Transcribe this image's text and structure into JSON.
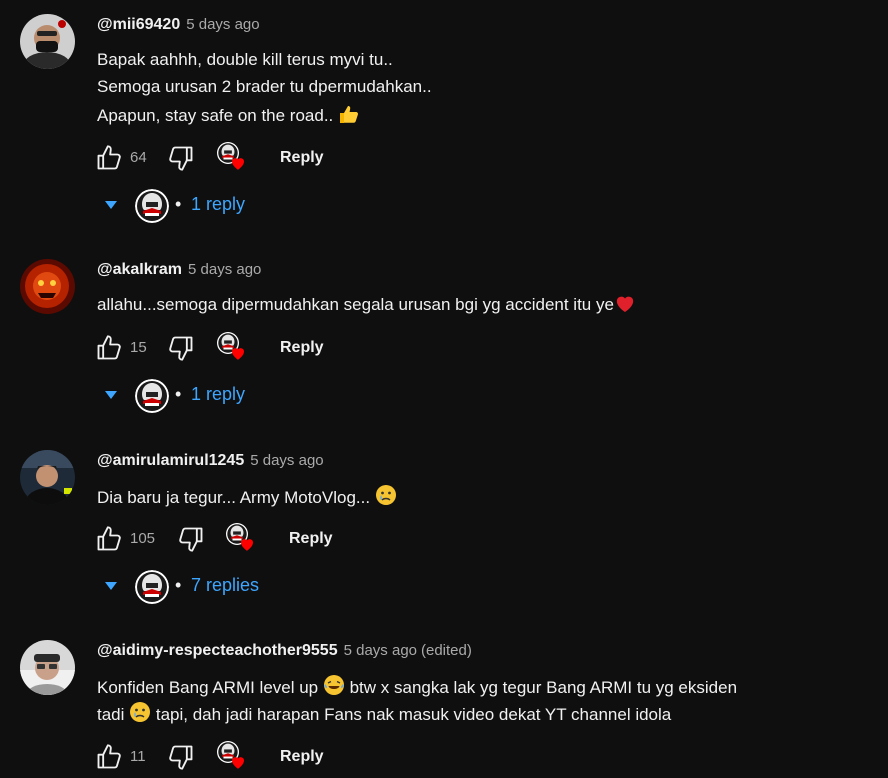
{
  "comments": [
    {
      "author": "@mii69420",
      "time": "5 days ago",
      "edited": "",
      "lines": [
        "Bapak aahhh, double kill terus myvi tu..",
        "Semoga urusan 2 brader tu dpermudahkan..",
        "Apapun, stay safe on the road.. "
      ],
      "emoji_end": "thumbs-up",
      "likes": "64",
      "reply_label": "Reply",
      "replies": "1 reply"
    },
    {
      "author": "@akaIkram",
      "time": "5 days ago",
      "edited": "",
      "lines": [
        "allahu...semoga dipermudahkan segala urusan bgi yg accident itu ye"
      ],
      "emoji_end": "red-heart",
      "likes": "15",
      "reply_label": "Reply",
      "replies": "1 reply"
    },
    {
      "author": "@amirulamirul1245",
      "time": "5 days ago",
      "edited": "",
      "lines": [
        "Dia baru ja tegur... Army MotoVlog... "
      ],
      "emoji_end": "crying-face",
      "likes": "105",
      "reply_label": "Reply",
      "replies": "7 replies"
    },
    {
      "author": "@aidimy-respecteachother9555",
      "time": "5 days ago",
      "edited": "(edited)",
      "line1a": "Konfiden Bang ARMI level up ",
      "line1b": " btw x sangka lak yg tegur Bang ARMI tu yg eksiden",
      "line2a": "tadi ",
      "line2b": " tapi, dah jadi harapan Fans nak masuk video dekat YT channel idola",
      "likes": "11",
      "reply_label": "Reply"
    }
  ],
  "colors": {
    "background": "#0f0f0f",
    "text": "#f1f1f1",
    "muted": "#aaaaaa",
    "link": "#3ea6ff",
    "heart": "#ff0000"
  }
}
